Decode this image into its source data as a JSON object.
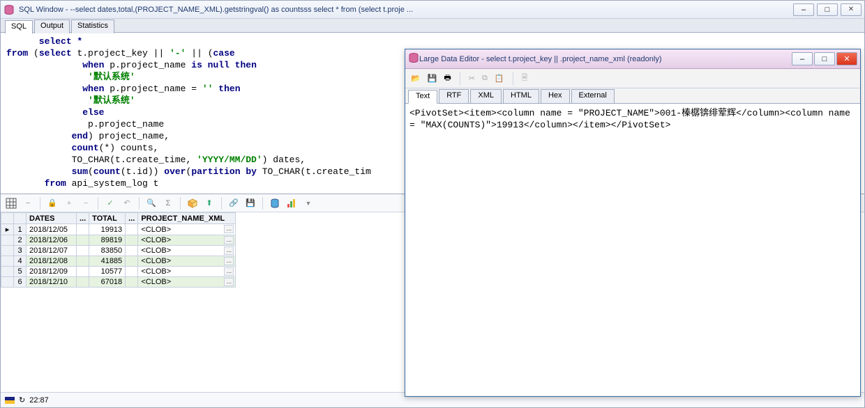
{
  "main": {
    "title": "SQL Window - --select dates,total,(PROJECT_NAME_XML).getstringval() as countsss select * from (select t.proje ...",
    "tabs": {
      "sql": "SQL",
      "output": "Output",
      "statistics": "Statistics"
    },
    "sql": {
      "l1": "      select *",
      "l2a": "from",
      "l2b": " (",
      "l2c": "select",
      "l2d": " t.project_key || ",
      "l2e": "'-'",
      "l2f": " || (",
      "l2g": "case",
      "l3a": "              when",
      "l3b": " p.project_name ",
      "l3c": "is null then",
      "l4": "               '默认系统'",
      "l5a": "              when",
      "l5b": " p.project_name = ",
      "l5c": "''",
      "l5d": " then",
      "l6": "               '默认系统'",
      "l7": "              else",
      "l8": "               p.project_name",
      "l9a": "            end",
      "l9b": ") project_name,",
      "l10a": "            count",
      "l10b": "(*) counts,",
      "l11a": "            TO_CHAR(t.create_time, ",
      "l11b": "'YYYY/MM/DD'",
      "l11c": ") dates,",
      "l12a": "            sum",
      "l12b": "(",
      "l12c": "count",
      "l12d": "(t.id)) ",
      "l12e": "over",
      "l12f": "(",
      "l12g": "partition by",
      "l12h": " TO_CHAR(t.create_tim",
      "l13a": "       from",
      "l13b": " api_system_log t"
    },
    "grid": {
      "headers": {
        "dates": "DATES",
        "total": "TOTAL",
        "xml": "PROJECT_NAME_XML",
        "last": "..."
      },
      "rows": [
        {
          "n": "1",
          "dates": "2018/12/05",
          "total": "19913",
          "xml": "<CLOB>"
        },
        {
          "n": "2",
          "dates": "2018/12/06",
          "total": "89819",
          "xml": "<CLOB>"
        },
        {
          "n": "3",
          "dates": "2018/12/07",
          "total": "83850",
          "xml": "<CLOB>"
        },
        {
          "n": "4",
          "dates": "2018/12/08",
          "total": "41885",
          "xml": "<CLOB>"
        },
        {
          "n": "5",
          "dates": "2018/12/09",
          "total": "10577",
          "xml": "<CLOB>"
        },
        {
          "n": "6",
          "dates": "2018/12/10",
          "total": "67018",
          "xml": "<CLOB>"
        }
      ]
    },
    "status": {
      "cursor": "22:87"
    }
  },
  "editor": {
    "title": "Large Data Editor - select t.project_key || .project_name_xml (readonly)",
    "tabs": {
      "text": "Text",
      "rtf": "RTF",
      "xml": "XML",
      "html": "HTML",
      "hex": "Hex",
      "external": "External"
    },
    "content": "<PivotSet><item><column name = \"PROJECT_NAME\">001-榛樼锛绯荤辉</column><column name = \"MAX(COUNTS)\">19913</column></item></PivotSet>"
  },
  "icons": {
    "folder": "📂",
    "save": "💾",
    "print": "🖶",
    "cut": "✂",
    "copy": "⧉",
    "paste": "📋",
    "doc": "🗎",
    "minimize": "–",
    "maximize": "□",
    "close": "✕"
  }
}
